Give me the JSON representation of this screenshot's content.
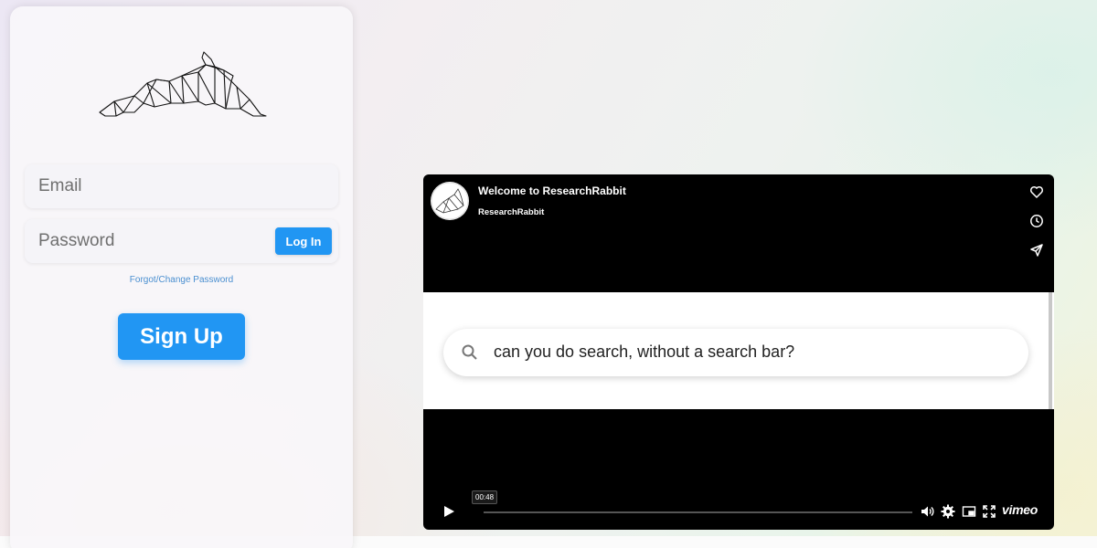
{
  "login": {
    "email_placeholder": "Email",
    "password_placeholder": "Password",
    "login_label": "Log In",
    "forgot_label": "Forgot/Change Password",
    "signup_label": "Sign Up"
  },
  "video": {
    "title": "Welcome to ResearchRabbit",
    "channel": "ResearchRabbit",
    "search_text": "can you do search, without a search bar?",
    "current_time": "00:48",
    "progress": 0.0,
    "brand": "vimeo",
    "side_actions": [
      "heart-icon",
      "clock-icon",
      "send-icon"
    ],
    "controls": [
      "play-icon",
      "volume-icon",
      "settings-icon",
      "pip-icon",
      "fullscreen-icon"
    ]
  },
  "colors": {
    "accent": "#2196f3",
    "link": "#4a8fd0",
    "player_bg": "#000000"
  }
}
